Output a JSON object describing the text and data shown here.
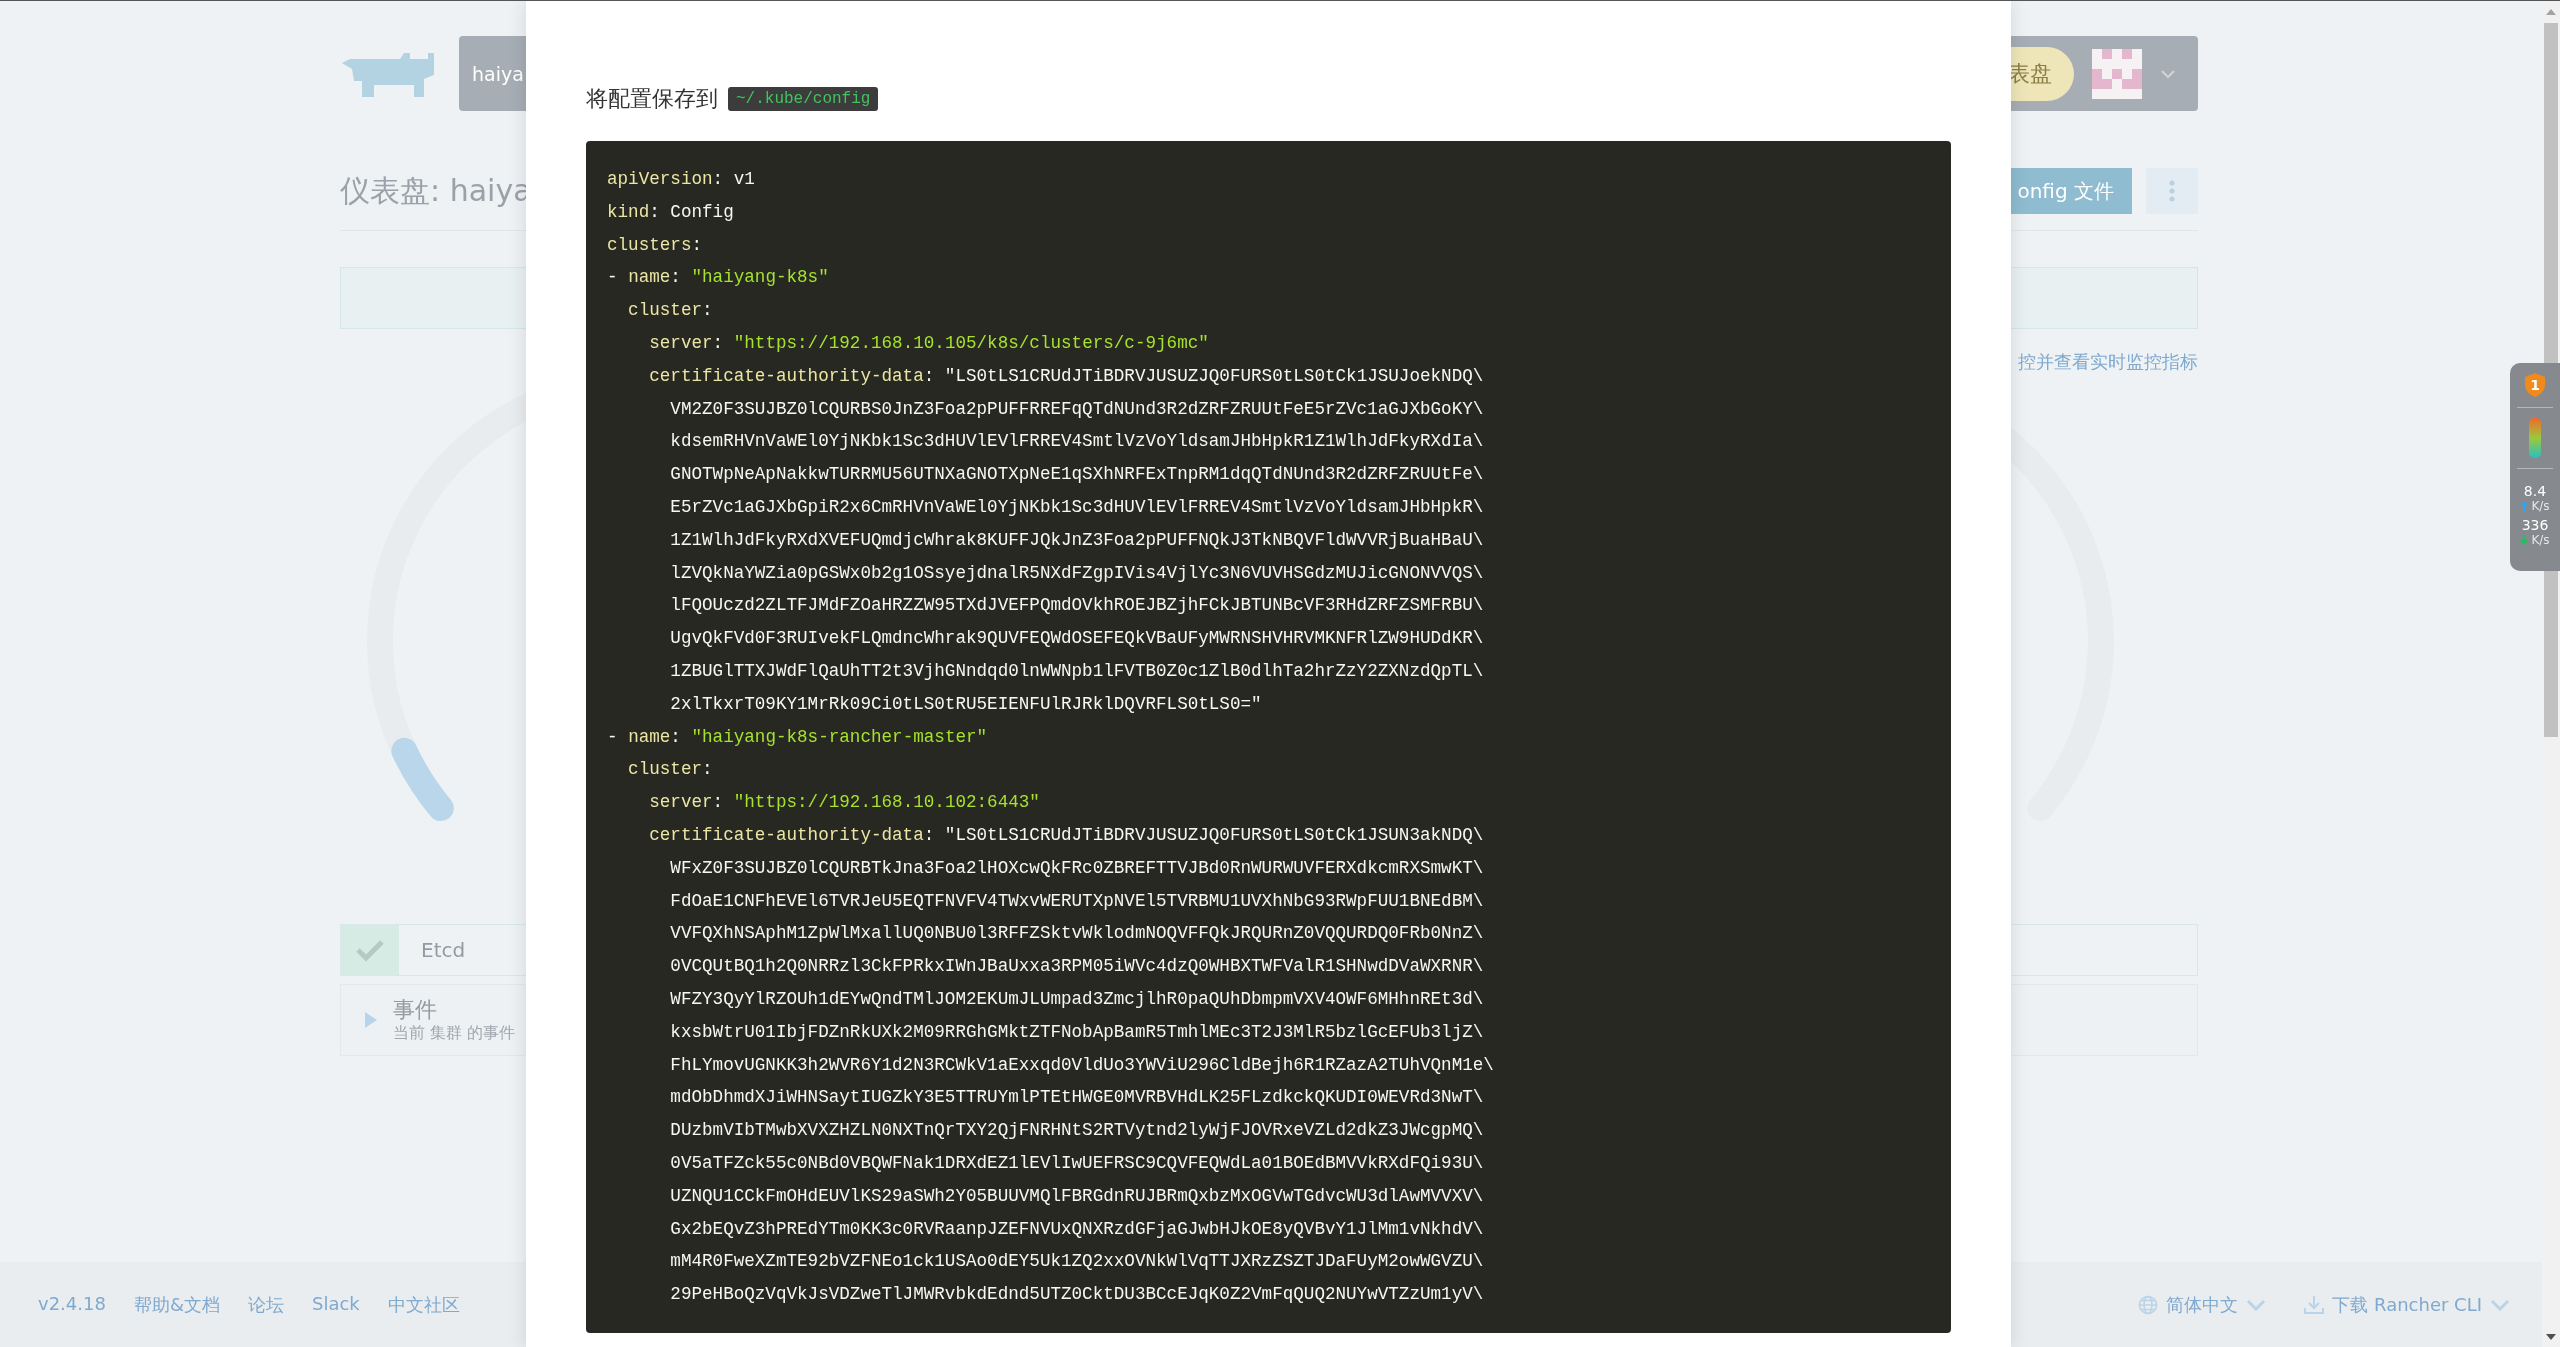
{
  "header": {
    "brand_text": "haiya",
    "pill_text": "表盘"
  },
  "title": "仪表盘: haiya",
  "kubeconfig_button": "onfig 文件",
  "monitoring_link": "控并查看实时监控指标",
  "etcd": {
    "label": "Etcd",
    "healthy": true
  },
  "events": {
    "title": "事件",
    "subtitle": "当前 集群 的事件",
    "expanded": false
  },
  "footer": {
    "left_links": [
      "v2.4.18",
      "帮助&文档",
      "论坛",
      "Slack",
      "中文社区"
    ],
    "language": "简体中文",
    "download": "下载 Rancher CLI"
  },
  "net_widget": {
    "badge": "1",
    "upload": "8.4",
    "upload_unit": "K/s",
    "download": "336",
    "download_unit": "K/s"
  },
  "modal": {
    "save_label": "将配置保存到",
    "path": "~/.kube/config",
    "code_lines": [
      {
        "tokens": [
          {
            "kind": "key",
            "text": "apiVersion"
          },
          {
            "kind": "plain",
            "text": ": v1"
          }
        ]
      },
      {
        "tokens": [
          {
            "kind": "key",
            "text": "kind"
          },
          {
            "kind": "plain",
            "text": ": Config"
          }
        ]
      },
      {
        "tokens": [
          {
            "kind": "key",
            "text": "clusters"
          },
          {
            "kind": "plain",
            "text": ":"
          }
        ]
      },
      {
        "tokens": [
          {
            "kind": "plain",
            "text": "- "
          },
          {
            "kind": "key",
            "text": "name"
          },
          {
            "kind": "plain",
            "text": ": "
          },
          {
            "kind": "str",
            "text": "\"haiyang-k8s\""
          }
        ]
      },
      {
        "tokens": [
          {
            "kind": "key",
            "text": "  cluster"
          },
          {
            "kind": "plain",
            "text": ":"
          }
        ]
      },
      {
        "tokens": [
          {
            "kind": "key",
            "text": "    server"
          },
          {
            "kind": "plain",
            "text": ": "
          },
          {
            "kind": "str",
            "text": "\"https://192.168.10.105/k8s/clusters/c-9j6mc\""
          }
        ]
      },
      {
        "tokens": [
          {
            "kind": "key",
            "text": "    certificate-authority-data"
          },
          {
            "kind": "plain",
            "text": ": \"LS0tLS1CRUdJTiBDRVJUSUZJQ0FURS0tLS0tCk1JSUJoekNDQ\\"
          }
        ]
      },
      {
        "tokens": [
          {
            "kind": "plain",
            "text": "      VM2Z0F3SUJBZ0lCQURBS0JnZ3Foa2pPUFFRREFqQTdNUnd3R2dZRFZRUUtFeE5rZVc1aGJXbGoKY\\"
          }
        ]
      },
      {
        "tokens": [
          {
            "kind": "plain",
            "text": "      kdsemRHVnVaWEl0YjNKbk1Sc3dHUVlEVlFRREV4SmtlVzVoYldsamJHbHpkR1Z1WlhJdFkyRXdIa\\"
          }
        ]
      },
      {
        "tokens": [
          {
            "kind": "plain",
            "text": "      GNOTWpNeApNakkwTURRMU56UTNXaGNOTXpNeE1qSXhNRFExTnpRM1dqQTdNUnd3R2dZRFZRUUtFe\\"
          }
        ]
      },
      {
        "tokens": [
          {
            "kind": "plain",
            "text": "      E5rZVc1aGJXbGpiR2x6CmRHVnVaWEl0YjNKbk1Sc3dHUVlEVlFRREV4SmtlVzVoYldsamJHbHpkR\\"
          }
        ]
      },
      {
        "tokens": [
          {
            "kind": "plain",
            "text": "      1Z1WlhJdFkyRXdXVEFUQmdjcWhrak8KUFFJQkJnZ3Foa2pPUFFNQkJ3TkNBQVFldWVVRjBuaHBaU\\"
          }
        ]
      },
      {
        "tokens": [
          {
            "kind": "plain",
            "text": "      lZVQkNaYWZia0pGSWx0b2g1OSsyejdnalR5NXdFZgpIVis4VjlYc3N6VUVHSGdzMUJicGNONVVQS\\"
          }
        ]
      },
      {
        "tokens": [
          {
            "kind": "plain",
            "text": "      lFQOUczd2ZLTFJMdFZOaHRZZW95TXdJVEFPQmdOVkhROEJBZjhFCkJBTUNBcVF3RHdZRFZSMFRBU\\"
          }
        ]
      },
      {
        "tokens": [
          {
            "kind": "plain",
            "text": "      UgvQkFVd0F3RUIvekFLQmdncWhrak9QUVFEQWdOSEFEQkVBaUFyMWRNSHVHRVMKNFRlZW9HUDdKR\\"
          }
        ]
      },
      {
        "tokens": [
          {
            "kind": "plain",
            "text": "      1ZBUGlTTXJWdFlQaUhTT2t3VjhGNndqd0lnWWNpb1lFVTB0Z0c1ZlB0dlhTa2hrZzY2ZXNzdQpTL\\"
          }
        ]
      },
      {
        "tokens": [
          {
            "kind": "plain",
            "text": "      2xlTkxrT09KY1MrRk09Ci0tLS0tRU5EIENFUlRJRklDQVRFLS0tLS0=\""
          }
        ]
      },
      {
        "tokens": [
          {
            "kind": "plain",
            "text": "- "
          },
          {
            "kind": "key",
            "text": "name"
          },
          {
            "kind": "plain",
            "text": ": "
          },
          {
            "kind": "str",
            "text": "\"haiyang-k8s-rancher-master\""
          }
        ]
      },
      {
        "tokens": [
          {
            "kind": "key",
            "text": "  cluster"
          },
          {
            "kind": "plain",
            "text": ":"
          }
        ]
      },
      {
        "tokens": [
          {
            "kind": "key",
            "text": "    server"
          },
          {
            "kind": "plain",
            "text": ": "
          },
          {
            "kind": "str",
            "text": "\"https://192.168.10.102:6443\""
          }
        ]
      },
      {
        "tokens": [
          {
            "kind": "key",
            "text": "    certificate-authority-data"
          },
          {
            "kind": "plain",
            "text": ": \"LS0tLS1CRUdJTiBDRVJUSUZJQ0FURS0tLS0tCk1JSUN3akNDQ\\"
          }
        ]
      },
      {
        "tokens": [
          {
            "kind": "plain",
            "text": "      WFxZ0F3SUJBZ0lCQURBTkJna3Foa2lHOXcwQkFRc0ZBREFTTVJBd0RnWURWUVFERXdkcmRXSmwKT\\"
          }
        ]
      },
      {
        "tokens": [
          {
            "kind": "plain",
            "text": "      FdOaE1CNFhEVEl6TVRJeU5EQTFNVFV4TWxvWERUTXpNVEl5TVRBMU1UVXhNbG93RWpFUU1BNEdBM\\"
          }
        ]
      },
      {
        "tokens": [
          {
            "kind": "plain",
            "text": "      VVFQXhNSAphM1ZpWlMxallUQ0NBU0l3RFFZSktvWklodmNOQVFFQkJRQURnZ0VQQURDQ0FRb0NnZ\\"
          }
        ]
      },
      {
        "tokens": [
          {
            "kind": "plain",
            "text": "      0VCQUtBQ1h2Q0NRRzl3CkFPRkxIWnJBaUxxa3RPM05iWVc4dzQ0WHBXTWFValR1SHNwdDVaWXRNR\\"
          }
        ]
      },
      {
        "tokens": [
          {
            "kind": "plain",
            "text": "      WFZY3QyYlRZOUh1dEYwQndTMlJOM2EKUmJLUmpad3ZmcjlhR0paQUhDbmpmVXV4OWF6MHhnREt3d\\"
          }
        ]
      },
      {
        "tokens": [
          {
            "kind": "plain",
            "text": "      kxsbWtrU01IbjFDZnRkUXk2M09RRGhGMktZTFNobApBamR5TmhlMEc3T2J3MlR5bzlGcEFUb3ljZ\\"
          }
        ]
      },
      {
        "tokens": [
          {
            "kind": "plain",
            "text": "      FhLYmovUGNKK3h2WVR6Y1d2N3RCWkV1aExxqd0VldUo3YWViU296CldBejh6R1RZazA2TUhVQnM1e\\"
          }
        ]
      },
      {
        "tokens": [
          {
            "kind": "plain",
            "text": "      mdObDhmdXJiWHNSaytIUGZkY3E5TTRUYmlPTEtHWGE0MVRBVHdLK25FLzdkckQKUDI0WEVRd3NwT\\"
          }
        ]
      },
      {
        "tokens": [
          {
            "kind": "plain",
            "text": "      DUzbmVIbTMwbXVXZHZLN0NXTnQrTXY2QjFNRHNtS2RTVytnd2lyWjFJOVRxeVZLd2dkZ3JWcgpMQ\\"
          }
        ]
      },
      {
        "tokens": [
          {
            "kind": "plain",
            "text": "      0V5aTFZck55c0NBd0VBQWFNak1DRXdEZ1lEVlIwUEFRSC9CQVFEQWdLa01BOEdBMVVkRXdFQi93U\\"
          }
        ]
      },
      {
        "tokens": [
          {
            "kind": "plain",
            "text": "      UZNQU1CCkFmOHdEUVlKS29aSWh2Y05BUUVMQlFBRGdnRUJBRmQxbzMxOGVwTGdvcWU3dlAwMVVXV\\"
          }
        ]
      },
      {
        "tokens": [
          {
            "kind": "plain",
            "text": "      Gx2bEQvZ3hPREdYTm0KK3c0RVRaanpJZEFNVUxQNXRzdGFjaGJwbHJkOE8yQVBvY1JlMm1vNkhdV\\"
          }
        ]
      },
      {
        "tokens": [
          {
            "kind": "plain",
            "text": "      mM4R0FweXZmTE92bVZFNEo1ck1USAo0dEY5Uk1ZQ2xxOVNkWlVqTTJXRzZSZTJDaFUyM2owWGVZU\\"
          }
        ]
      },
      {
        "tokens": [
          {
            "kind": "plain",
            "text": "      29PeHBoQzVqVkJsVDZweTlJMWRvbkdEdnd5UTZ0CktDU3BCcEJqK0Z2VmFqQUQ2NUYwVTZzUm1yV\\"
          }
        ]
      }
    ]
  }
}
